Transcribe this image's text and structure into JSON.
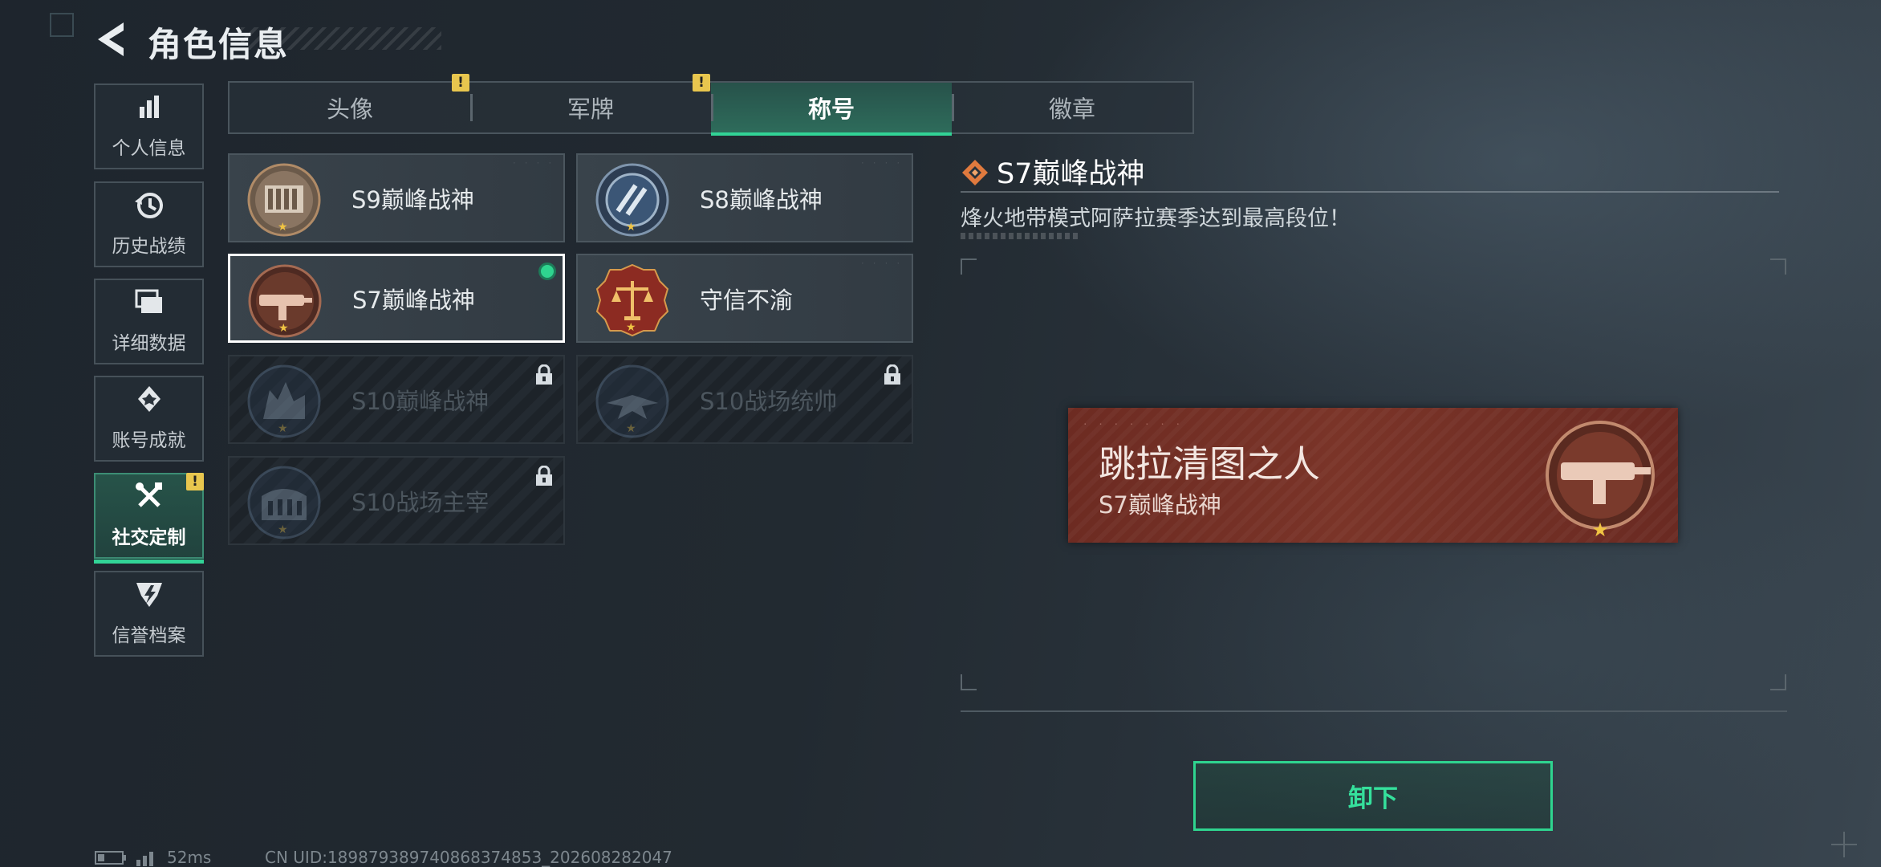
{
  "header": {
    "title": "角色信息"
  },
  "sidebar": {
    "items": [
      {
        "label": "个人信息",
        "icon": "bar-chart-icon"
      },
      {
        "label": "历史战绩",
        "icon": "history-clock-icon"
      },
      {
        "label": "详细数据",
        "icon": "folder-stack-icon"
      },
      {
        "label": "账号成就",
        "icon": "achievement-medal-icon"
      },
      {
        "label": "社交定制",
        "icon": "tools-icon",
        "active": true,
        "warning": "!"
      },
      {
        "label": "信誉档案",
        "icon": "credit-shield-icon"
      }
    ]
  },
  "tabs": [
    {
      "label": "头像",
      "warning": "!"
    },
    {
      "label": "军牌",
      "warning": "!"
    },
    {
      "label": "称号",
      "active": true
    },
    {
      "label": "徽章"
    }
  ],
  "titles": [
    {
      "name": "S9巅峰战神",
      "medal": "building-medal-icon",
      "locked": false
    },
    {
      "name": "S8巅峰战神",
      "medal": "blue-emblem-medal-icon",
      "locked": false
    },
    {
      "name": "S7巅峰战神",
      "medal": "gun-medal-icon",
      "locked": false,
      "selected": true,
      "equipped": true
    },
    {
      "name": "守信不渝",
      "medal": "scales-medal-icon",
      "locked": false
    },
    {
      "name": "S10巅峰战神",
      "medal": "ruins-medal-icon",
      "locked": true
    },
    {
      "name": "S10战场统帅",
      "medal": "aircraft-medal-icon",
      "locked": true
    },
    {
      "name": "S10战场主宰",
      "medal": "colosseum-medal-icon",
      "locked": true
    }
  ],
  "detail": {
    "title": "S7巅峰战神",
    "description": "烽火地带模式阿萨拉赛季达到最高段位！",
    "preview_main": "跳拉清图之人",
    "preview_sub": "S7巅峰战神",
    "button_label": "卸下"
  },
  "status": {
    "ping": "52ms",
    "uid": "CN UID:189879389740868374853_202608282047"
  },
  "colors": {
    "accent_green": "#32d396",
    "warning_yellow": "#e8c64e",
    "preview_red": "#7a3428"
  }
}
